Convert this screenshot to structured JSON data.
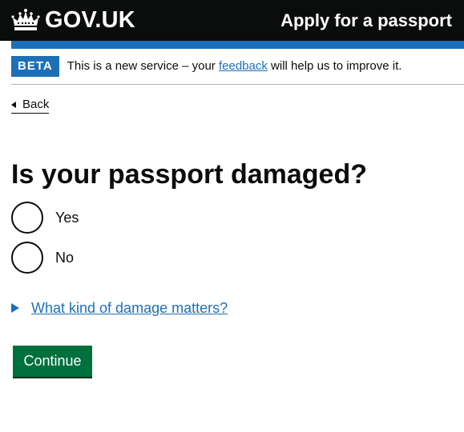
{
  "header": {
    "logo_text": "GOV.UK",
    "service_name": "Apply for a passport",
    "brand_color": "#1d70b8"
  },
  "phase_banner": {
    "tag": "BETA",
    "text_before": "This is a new service – your ",
    "link_text": "feedback",
    "text_after": " will help us to improve it."
  },
  "back_link": {
    "label": "Back"
  },
  "question": {
    "title": "Is your passport damaged?",
    "options": [
      {
        "label": "Yes",
        "selected": false
      },
      {
        "label": "No",
        "selected": false
      }
    ]
  },
  "details": {
    "summary": "What kind of damage matters?"
  },
  "continue_button": {
    "label": "Continue",
    "color": "#00703c"
  },
  "icons": [
    "crown-icon",
    "back-arrow-icon",
    "details-arrow-icon"
  ]
}
